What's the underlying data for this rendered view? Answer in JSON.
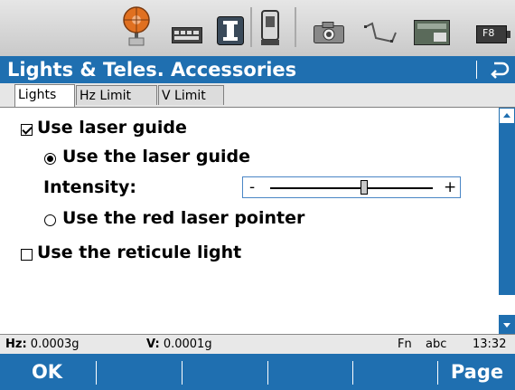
{
  "iconbar": {
    "icons": [
      "prism-target-icon",
      "keyboard-icon",
      "instrument-icon",
      "total-station-icon",
      "camera-icon",
      "survey-line-icon",
      "card-icon",
      "battery-icon"
    ],
    "battery_label": "F8"
  },
  "titlebar": {
    "title": "Lights & Teles. Accessories"
  },
  "tabs": [
    {
      "label": "Lights",
      "active": true
    },
    {
      "label": "Hz Limit",
      "active": false
    },
    {
      "label": "V Limit",
      "active": false
    }
  ],
  "content": {
    "use_laser_guide": {
      "label": "Use laser guide",
      "checked": true
    },
    "laser_guide_option": {
      "label": "Use the laser guide",
      "selected": true
    },
    "intensity": {
      "label": "Intensity:",
      "minus": "-",
      "plus": "+",
      "level": 0.58
    },
    "red_laser_option": {
      "label": "Use the red laser pointer",
      "selected": false
    },
    "reticule_light": {
      "label": "Use the reticule light",
      "checked": false
    }
  },
  "statusbar": {
    "hz_label": "Hz:",
    "hz_value": "0.0003g",
    "v_label": "V:",
    "v_value": "0.0001g",
    "fn": "Fn",
    "mode": "abc",
    "time": "13:32"
  },
  "softkeys": {
    "ok": "OK",
    "page": "Page"
  },
  "colors": {
    "accent": "#1f6fb0",
    "prism": "#e07020"
  }
}
